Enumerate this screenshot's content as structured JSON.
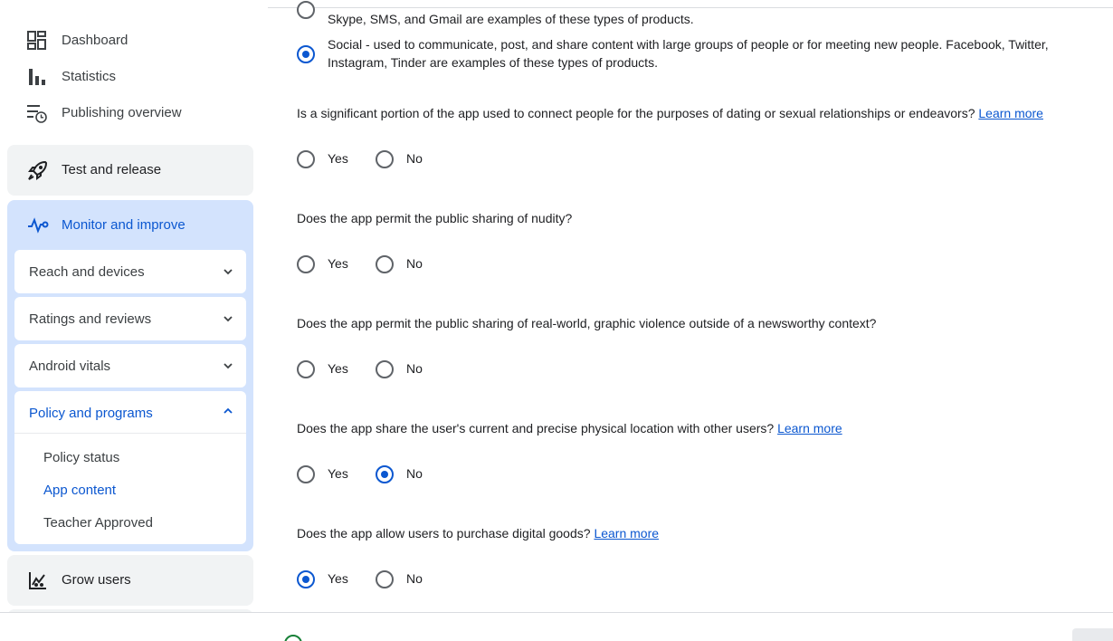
{
  "sidebar": {
    "top_items": [
      {
        "label": "Dashboard",
        "icon": "dashboard-icon"
      },
      {
        "label": "Statistics",
        "icon": "bar-chart-icon"
      },
      {
        "label": "Publishing overview",
        "icon": "publishing-overview-icon"
      }
    ],
    "test_release": {
      "label": "Test and release",
      "icon": "rocket-icon"
    },
    "monitor": {
      "label": "Monitor and improve",
      "icon": "pulse-icon",
      "subsections": [
        {
          "label": "Reach and devices"
        },
        {
          "label": "Ratings and reviews"
        },
        {
          "label": "Android vitals"
        }
      ],
      "policy": {
        "label": "Policy and programs",
        "items": [
          {
            "label": "Policy status"
          },
          {
            "label": "App content"
          },
          {
            "label": "Teacher Approved"
          }
        ]
      }
    },
    "grow_users": {
      "label": "Grow users",
      "icon": "grow-users-icon"
    }
  },
  "main": {
    "prev_option_text": "Skype, SMS, and Gmail are examples of these types of products.",
    "social_option_text_line1": "Social - used to communicate, post, and share content with large groups of people or for meeting new people. Facebook, Twitter,",
    "social_option_text_line2": "Instagram, Tinder are examples of these types of products.",
    "questions": [
      {
        "text": "Is a significant portion of the app used to connect people for the purposes of dating or sexual relationships or endeavors?",
        "link": "Learn more",
        "selected": "none"
      },
      {
        "text": "Does the app permit the public sharing of nudity?",
        "link": "",
        "selected": "none"
      },
      {
        "text": "Does the app permit the public sharing of real-world, graphic violence outside of a newsworthy context?",
        "link": "",
        "selected": "none"
      },
      {
        "text": "Does the app share the user's current and precise physical location with other users?",
        "link": "Learn more",
        "selected": "no"
      },
      {
        "text": "Does the app allow users to purchase digital goods?",
        "link": "Learn more",
        "selected": "yes"
      }
    ],
    "yes_label": "Yes",
    "no_label": "No"
  },
  "colors": {
    "accent": "#0b57d0",
    "monitor_bg": "#d3e3fd",
    "card_bg": "#f1f3f4"
  }
}
